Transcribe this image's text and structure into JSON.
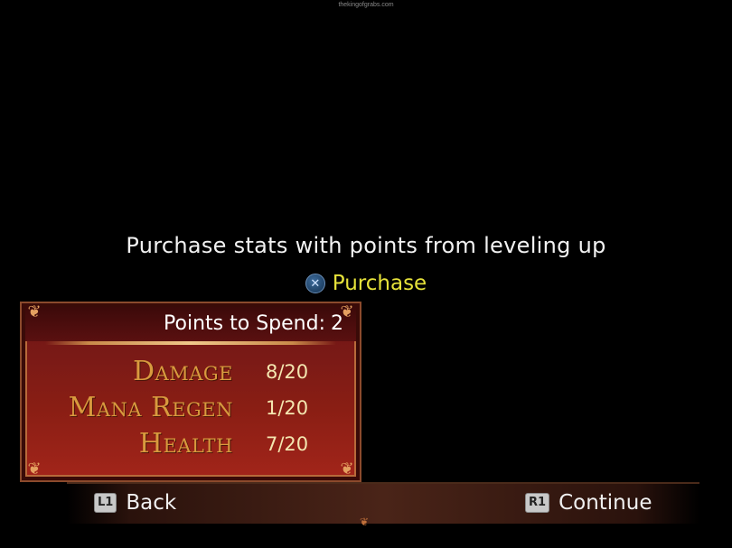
{
  "watermark": "thekingofgrabs.com",
  "instruction": "Purchase stats with points from leveling up",
  "purchase_hint": {
    "button_icon": "cross-button-icon",
    "button_glyph": "✕",
    "label": "Purchase"
  },
  "panel": {
    "points_label": "Points to Spend:",
    "points_value": "2",
    "stats": [
      {
        "name": "Damage",
        "value": "8/20"
      },
      {
        "name": "Mana Regen",
        "value": "1/20"
      },
      {
        "name": "Health",
        "value": "7/20"
      }
    ]
  },
  "nav": {
    "back": {
      "button": "L1",
      "label": "Back"
    },
    "continue": {
      "button": "R1",
      "label": "Continue"
    }
  },
  "colors": {
    "stat_name": "#d89a3e",
    "purchase_label": "#e6e23a",
    "panel_bg": "#7a1a16"
  }
}
